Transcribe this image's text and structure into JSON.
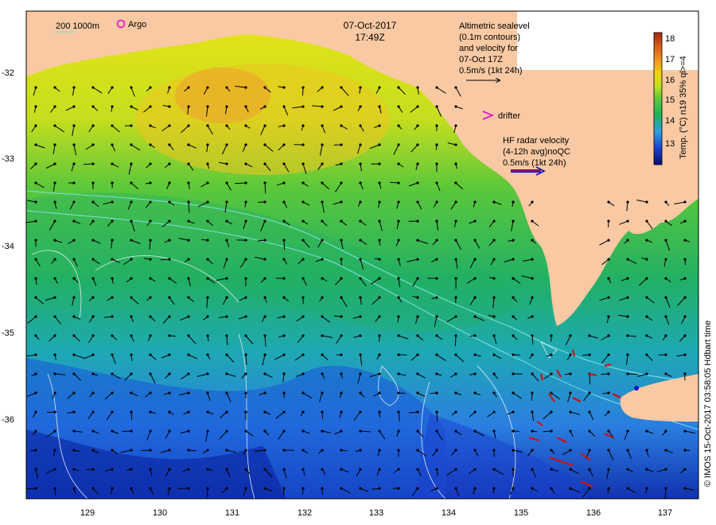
{
  "header": {
    "date": "07-Oct-2017",
    "time": "17:49Z"
  },
  "legend": {
    "isobath_label": "200  1000m",
    "argo_label": "Argo",
    "altimetry_lines": [
      "Altimetric sealevel",
      "(0.1m contours)",
      "and velocity for",
      "07-Oct 17Z",
      "0.5m/s (1kt 24h)"
    ],
    "drifter_label": "drifter",
    "radar_lines": [
      "HF radar velocity",
      "(4-12h avg)noQC",
      "0.5m/s (1kt 24h)"
    ]
  },
  "colorbar": {
    "title": "Temp. (°C) n19 35% ql>=4",
    "ticks": [
      "18",
      "17",
      "16",
      "15",
      "14",
      "13"
    ],
    "stops": [
      "#08086e",
      "#1a3fd0",
      "#2aa0e0",
      "#1db35a",
      "#5cc83a",
      "#c8e01c",
      "#f0d010",
      "#f09020",
      "#d85a14",
      "#a82810"
    ]
  },
  "axes": {
    "lat_labels": [
      "-32",
      "-33",
      "-34",
      "-35",
      "-36"
    ],
    "lon_labels": [
      "129",
      "130",
      "131",
      "132",
      "133",
      "134",
      "135",
      "136",
      "137"
    ]
  },
  "credit": "© IMOS 15-Oct-2017 03:58:05 Hdbart time",
  "colors": {
    "land": "#f9c9a3",
    "argo": "#e000e0",
    "drifter": "#e000e0",
    "radar_arrow": "#d01010",
    "radar_arrow_outline": "#1010c0",
    "isobath": "#7fe0e0"
  }
}
